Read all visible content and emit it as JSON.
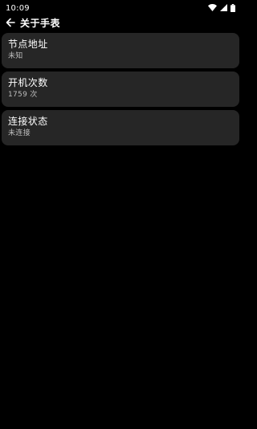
{
  "status_bar": {
    "time": "10:09",
    "icons": [
      "wifi-icon",
      "signal-icon",
      "battery-icon"
    ]
  },
  "app_bar": {
    "back_icon": "back-arrow-icon",
    "title": "关于手表"
  },
  "items": [
    {
      "title": "节点地址",
      "subtitle": "未知"
    },
    {
      "title": "开机次数",
      "subtitle": "1759 次"
    },
    {
      "title": "连接状态",
      "subtitle": "未连接"
    }
  ],
  "colors": {
    "background": "#000000",
    "card": "#262626",
    "primary_text": "#ffffff",
    "secondary_text": "#bdbdbd"
  }
}
